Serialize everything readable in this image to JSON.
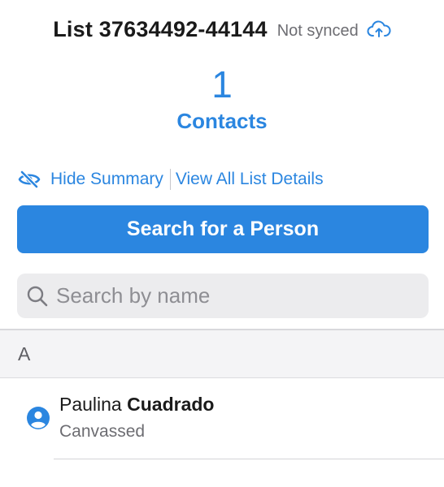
{
  "header": {
    "list_title": "List 37634492-44144",
    "sync_status": "Not synced",
    "sync_icon": "cloud-upload-icon"
  },
  "summary": {
    "count": "1",
    "count_label": "Contacts"
  },
  "links": {
    "hide_summary": "Hide Summary",
    "hide_icon": "eye-slash-icon",
    "view_details": "View All List Details"
  },
  "search_person_button": {
    "label": "Search for a Person"
  },
  "search": {
    "placeholder": "Search by name",
    "value": "",
    "icon": "magnifier-icon"
  },
  "sections": [
    {
      "letter": "A",
      "contacts": [
        {
          "first_name": "Paulina",
          "last_name": "Cuadrado",
          "status": "Canvassed",
          "icon": "person-circle-icon"
        }
      ]
    }
  ],
  "colors": {
    "accent": "#2b86e0",
    "text": "#1a1a1a",
    "secondary_text": "#6d6d72",
    "search_bg": "#ececee",
    "section_bg": "#f4f4f6"
  }
}
